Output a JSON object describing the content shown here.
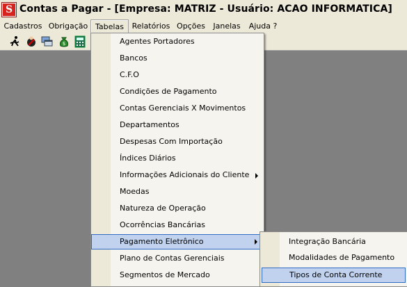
{
  "window": {
    "title": "Contas a Pagar - [Empresa: MATRIZ - Usuário: ACAO INFORMATICA]",
    "logo_letter": "S"
  },
  "menubar": {
    "items": [
      {
        "label": "Cadastros"
      },
      {
        "label": "Obrigação"
      },
      {
        "label": "Tabelas"
      },
      {
        "label": "Relatórios"
      },
      {
        "label": "Opções"
      },
      {
        "label": "Janelas"
      },
      {
        "label": "Ajuda ?"
      }
    ],
    "active": "Tabelas"
  },
  "toolbar": {
    "icons": [
      "running-man-icon",
      "person-stop-icon",
      "windows-icon",
      "money-bag-icon",
      "calculator-icon"
    ]
  },
  "tabelas_menu": {
    "items": [
      {
        "label": "Agentes Portadores"
      },
      {
        "label": "Bancos"
      },
      {
        "label": "C.F.O"
      },
      {
        "label": "Condições de Pagamento"
      },
      {
        "label": "Contas Gerenciais X Movimentos"
      },
      {
        "label": "Departamentos"
      },
      {
        "label": "Despesas Com Importação"
      },
      {
        "label": "Índices Diários"
      },
      {
        "label": "Informações Adicionais do Cliente"
      },
      {
        "label": "Moedas"
      },
      {
        "label": "Natureza de Operação"
      },
      {
        "label": "Ocorrências Bancárias"
      },
      {
        "label": "Pagamento Eletrônico"
      },
      {
        "label": "Plano de Contas Gerenciais"
      },
      {
        "label": "Segmentos de Mercado"
      }
    ]
  },
  "pagamento_submenu": {
    "items": [
      {
        "label": "Integração Bancária"
      },
      {
        "label": "Modalidades de Pagamento"
      },
      {
        "label": "Tipos de Conta Corrente"
      }
    ]
  },
  "colors": {
    "chrome": "#ece9d8",
    "desktop": "#808080",
    "highlight": "#c1d2ee",
    "highlight_border": "#316ac5",
    "logo_red": "#d6231e"
  }
}
